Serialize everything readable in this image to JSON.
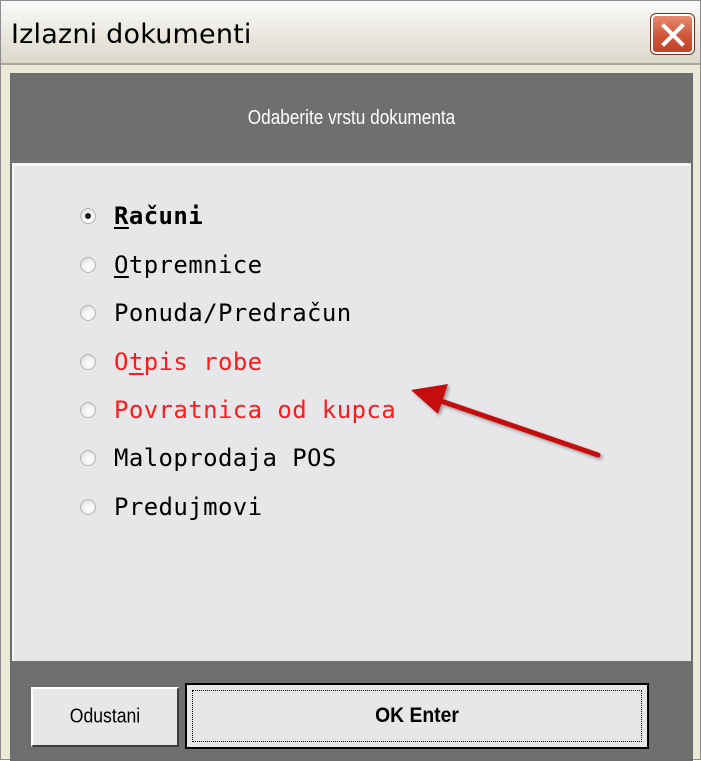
{
  "window": {
    "title": "Izlazni dokumenti",
    "close_icon": "close-x-icon"
  },
  "header": {
    "subtitle": "Odaberite vrstu dokumenta"
  },
  "options": [
    {
      "label_pre": "",
      "label_ul": "R",
      "label_post": "ačuni",
      "checked": true,
      "color": "#000000"
    },
    {
      "label_pre": "",
      "label_ul": "O",
      "label_post": "tpremnice",
      "checked": false,
      "color": "#000000"
    },
    {
      "label_pre": "Ponuda/Predračun",
      "label_ul": "",
      "label_post": "",
      "checked": false,
      "color": "#000000"
    },
    {
      "label_pre": "O",
      "label_ul": "t",
      "label_post": "pis robe",
      "checked": false,
      "color": "#ff1a1a"
    },
    {
      "label_pre": "Povratnica od kupca",
      "label_ul": "",
      "label_post": "",
      "checked": false,
      "color": "#ff1a1a"
    },
    {
      "label_pre": "Maloprodaja POS",
      "label_ul": "",
      "label_post": "",
      "checked": false,
      "color": "#000000"
    },
    {
      "label_pre": "Predujmovi",
      "label_ul": "",
      "label_post": "",
      "checked": false,
      "color": "#000000"
    }
  ],
  "buttons": {
    "cancel": "Odustani",
    "ok": "OK Enter"
  },
  "annotation": {
    "icon": "red-arrow-icon",
    "color": "#c41010"
  }
}
